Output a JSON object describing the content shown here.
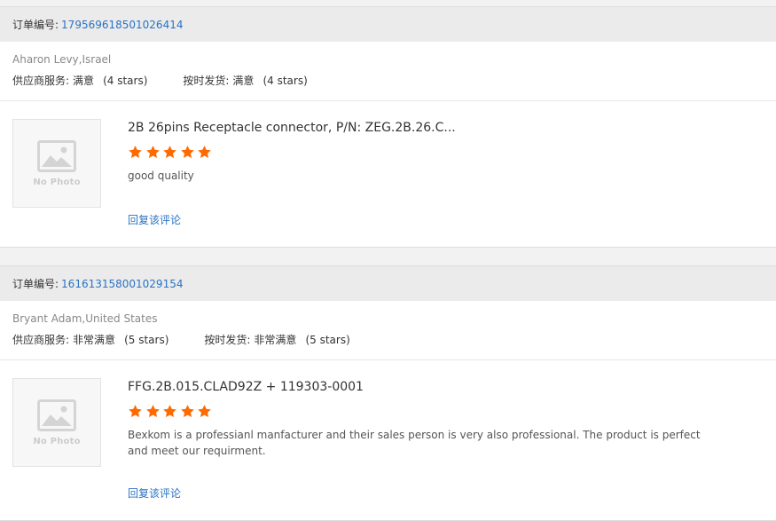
{
  "orders": [
    {
      "order_label": "订单编号:",
      "order_number": "179569618501026414",
      "buyer": "Aharon Levy,Israel",
      "supplier_service_label": "供应商服务:",
      "supplier_service_value": "满意",
      "supplier_service_stars": "(4 stars)",
      "delivery_label": "按时发货:",
      "delivery_value": "满意",
      "delivery_stars": "(4 stars)",
      "product_title": "2B 26pins Receptacle connector, P/N: ZEG.2B.26.C...",
      "rating": 5,
      "comment": "good quality",
      "photo_placeholder": "No Photo",
      "reply_label": "回复该评论"
    },
    {
      "order_label": "订单编号:",
      "order_number": "161613158001029154",
      "buyer": "Bryant Adam,United States",
      "supplier_service_label": "供应商服务:",
      "supplier_service_value": "非常满意",
      "supplier_service_stars": "(5 stars)",
      "delivery_label": "按时发货:",
      "delivery_value": "非常满意",
      "delivery_stars": "(5 stars)",
      "product_title": "FFG.2B.015.CLAD92Z + 119303-0001",
      "rating": 5,
      "comment": "Bexkom is a professianl manfacturer and their sales person is very also professional. The product is perfect and meet our requirment.",
      "photo_placeholder": "No Photo",
      "reply_label": "回复该评论"
    }
  ],
  "colors": {
    "star": "#ff6a00",
    "link": "#2a73c4",
    "header_bg": "#ebebeb"
  },
  "icons": {
    "star": "star-icon",
    "photo": "image-placeholder-icon"
  }
}
